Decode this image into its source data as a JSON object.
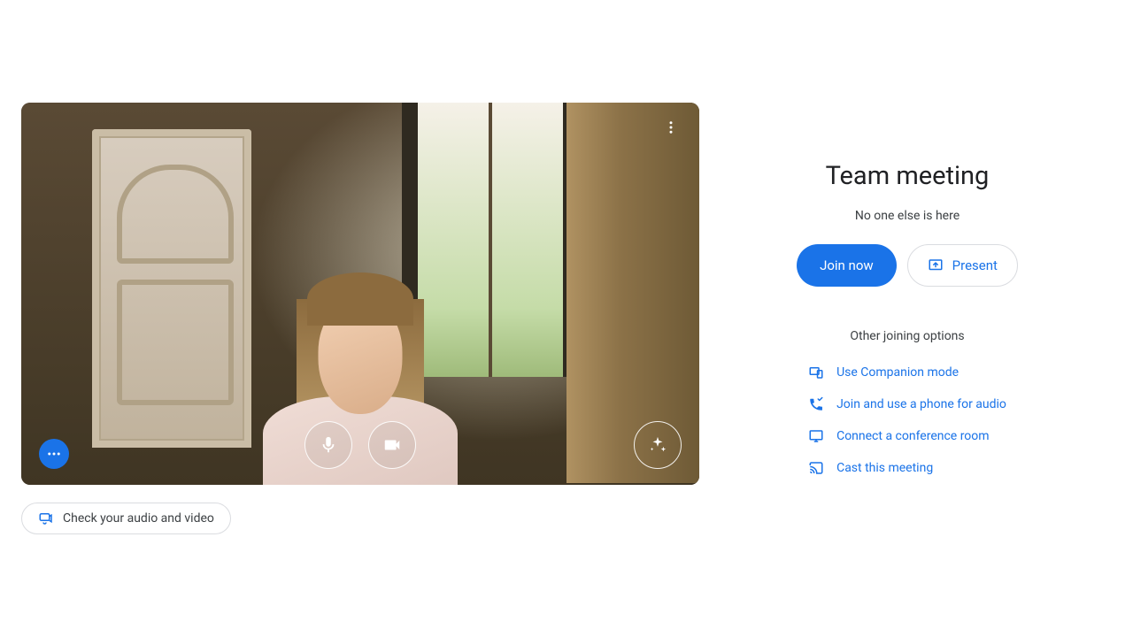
{
  "preview": {
    "check_av_label": "Check your audio and video"
  },
  "meeting": {
    "title": "Team meeting",
    "presence": "No one else is here",
    "join_label": "Join now",
    "present_label": "Present",
    "other_options_heading": "Other joining options",
    "options": {
      "companion": "Use Companion mode",
      "phone_audio": "Join and use a phone for audio",
      "conference_room": "Connect a conference room",
      "cast": "Cast this meeting"
    }
  }
}
